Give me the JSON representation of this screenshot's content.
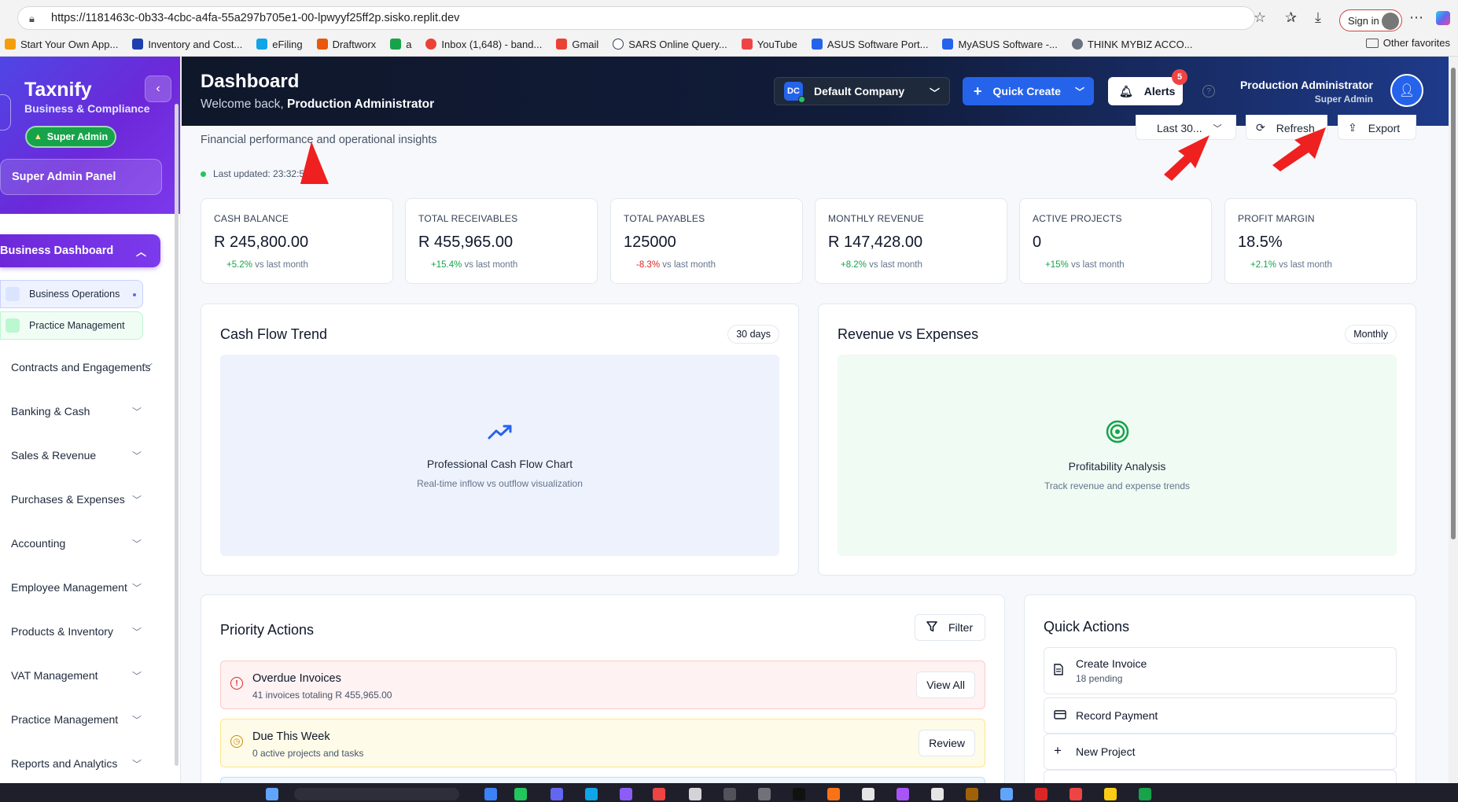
{
  "browser": {
    "url": "https://1181463c-0b33-4cbc-a4fa-55a297b705e1-00-lpwyyf25ff2p.sisko.replit.dev",
    "sign_in": "Sign in",
    "bookmarks": [
      {
        "label": "Start Your Own App...",
        "color": "#f59e0b"
      },
      {
        "label": "Inventory and Cost...",
        "color": "#1e40af"
      },
      {
        "label": "eFiling",
        "color": "#0ea5e9"
      },
      {
        "label": "Draftworx",
        "color": "#ea580c"
      },
      {
        "label": "a",
        "color": "#16a34a"
      },
      {
        "label": "Inbox (1,648) - band...",
        "color": "#ea4335"
      },
      {
        "label": "Gmail",
        "color": "#ea4335"
      },
      {
        "label": "SARS Online Query...",
        "color": "#374151"
      },
      {
        "label": "YouTube",
        "color": "#ef4444"
      },
      {
        "label": "ASUS Software Port...",
        "color": "#2563eb"
      },
      {
        "label": "MyASUS Software -...",
        "color": "#2563eb"
      },
      {
        "label": "THINK MYBIZ ACCO...",
        "color": "#6b7280"
      }
    ],
    "other_favorites": "Other favorites"
  },
  "sidebar": {
    "brand": "Taxnify",
    "brand_sub": "Business & Compliance",
    "badge": "Super Admin",
    "panel": "Super Admin Panel",
    "active": "Business Dashboard",
    "sub_items": [
      "Business Operations",
      "Practice Management"
    ],
    "items": [
      "Contracts and Engagements",
      "Banking & Cash",
      "Sales & Revenue",
      "Purchases & Expenses",
      "Accounting",
      "Employee Management",
      "Products & Inventory",
      "VAT Management",
      "Practice Management",
      "Reports and Analytics"
    ]
  },
  "header": {
    "title": "Dashboard",
    "welcome_prefix": "Welcome back,",
    "welcome_name": "Production Administrator",
    "company_initials": "DC",
    "company": "Default Company",
    "quick_create": "Quick Create",
    "alerts": "Alerts",
    "alerts_count": "5",
    "help": "?",
    "user_name": "Production Administrator",
    "user_role": "Super Admin"
  },
  "page": {
    "subtitle": "Financial performance and operational insights",
    "updated": "Last updated: 23:32:59",
    "range": "Last 30...",
    "refresh": "Refresh",
    "export": "Export"
  },
  "kpis": [
    {
      "label": "Cash Balance",
      "value": "R 245,800.00",
      "change": "+5.2%",
      "dir": "up",
      "suffix": "vs last month"
    },
    {
      "label": "Total Receivables",
      "value": "R 455,965.00",
      "change": "+15.4%",
      "dir": "up",
      "suffix": "vs last month"
    },
    {
      "label": "Total Payables",
      "value": "125000",
      "change": "-8.3%",
      "dir": "down",
      "suffix": "vs last month"
    },
    {
      "label": "Monthly Revenue",
      "value": "R 147,428.00",
      "change": "+8.2%",
      "dir": "up",
      "suffix": "vs last month"
    },
    {
      "label": "Active Projects",
      "value": "0",
      "change": "+15%",
      "dir": "up",
      "suffix": "vs last month"
    },
    {
      "label": "Profit Margin",
      "value": "18.5%",
      "change": "+2.1%",
      "dir": "up",
      "suffix": "vs last month"
    }
  ],
  "cashflow": {
    "title": "Cash Flow Trend",
    "pill": "30 days",
    "ph_title": "Professional Cash Flow Chart",
    "ph_sub": "Real-time inflow vs outflow visualization"
  },
  "revexp": {
    "title": "Revenue vs Expenses",
    "pill": "Monthly",
    "ph_title": "Profitability Analysis",
    "ph_sub": "Track revenue and expense trends"
  },
  "priority": {
    "title": "Priority Actions",
    "filter": "Filter",
    "items": [
      {
        "title": "Overdue Invoices",
        "sub": "41 invoices totaling R 455,965.00",
        "button": "View All"
      },
      {
        "title": "Due This Week",
        "sub": "0 active projects and tasks",
        "button": "Review"
      }
    ]
  },
  "quick_actions": {
    "title": "Quick Actions",
    "items": [
      {
        "label": "Create Invoice",
        "sub": "18 pending"
      },
      {
        "label": "Record Payment"
      },
      {
        "label": "New Project"
      }
    ]
  },
  "colors": {
    "accent": "#2563eb",
    "sidebar_gradient": "#6d28d9",
    "positive": "#16a34a",
    "negative": "#dc2626",
    "annotation": "#ef2020"
  }
}
